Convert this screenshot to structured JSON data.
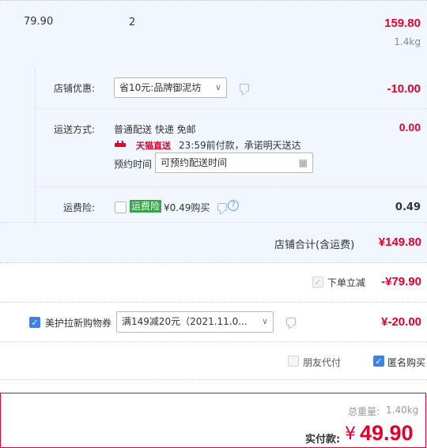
{
  "item": {
    "unit_price": "79.90",
    "quantity": "2",
    "subtotal": "159.80",
    "weight": "1.4kg"
  },
  "discount": {
    "label": "店铺优惠:",
    "select_value": "省10元:品牌御泥坊",
    "amount": "-10.00"
  },
  "shipping": {
    "label": "运送方式:",
    "method": "普通配送 快递 免邮",
    "brand": "天猫直送",
    "promise": "23:59前付款，承诺明天送达",
    "schedule_label": "预约时间",
    "schedule_placeholder": "可预约配送时间",
    "amount": "0.00"
  },
  "insurance": {
    "label": "运费险:",
    "badge": "运费险",
    "price_text": "¥0.49购买",
    "amount": "0.49"
  },
  "store_total": {
    "label": "店铺合计(含运费)",
    "amount": "¥149.80"
  },
  "instant_discount": {
    "label": "下单立减",
    "amount": "-¥79.90"
  },
  "coupon": {
    "label": "美护拉新购物券",
    "select_value": "满149减20元（2021.11.0...",
    "amount": "¥-20.00"
  },
  "options": {
    "friend_pay": "朋友代付",
    "anonymous": "匿名购买"
  },
  "summary": {
    "weight_label": "总重量:",
    "weight_value": "1.40kg",
    "pay_label": "实付款:",
    "currency": "¥",
    "pay_amount": "49.90"
  },
  "colors": {
    "accent_red": "#e4002b",
    "checkbox_blue": "#3f7fe6",
    "panel_blue": "#f2f7ff",
    "badge_green": "#3aa14b"
  }
}
